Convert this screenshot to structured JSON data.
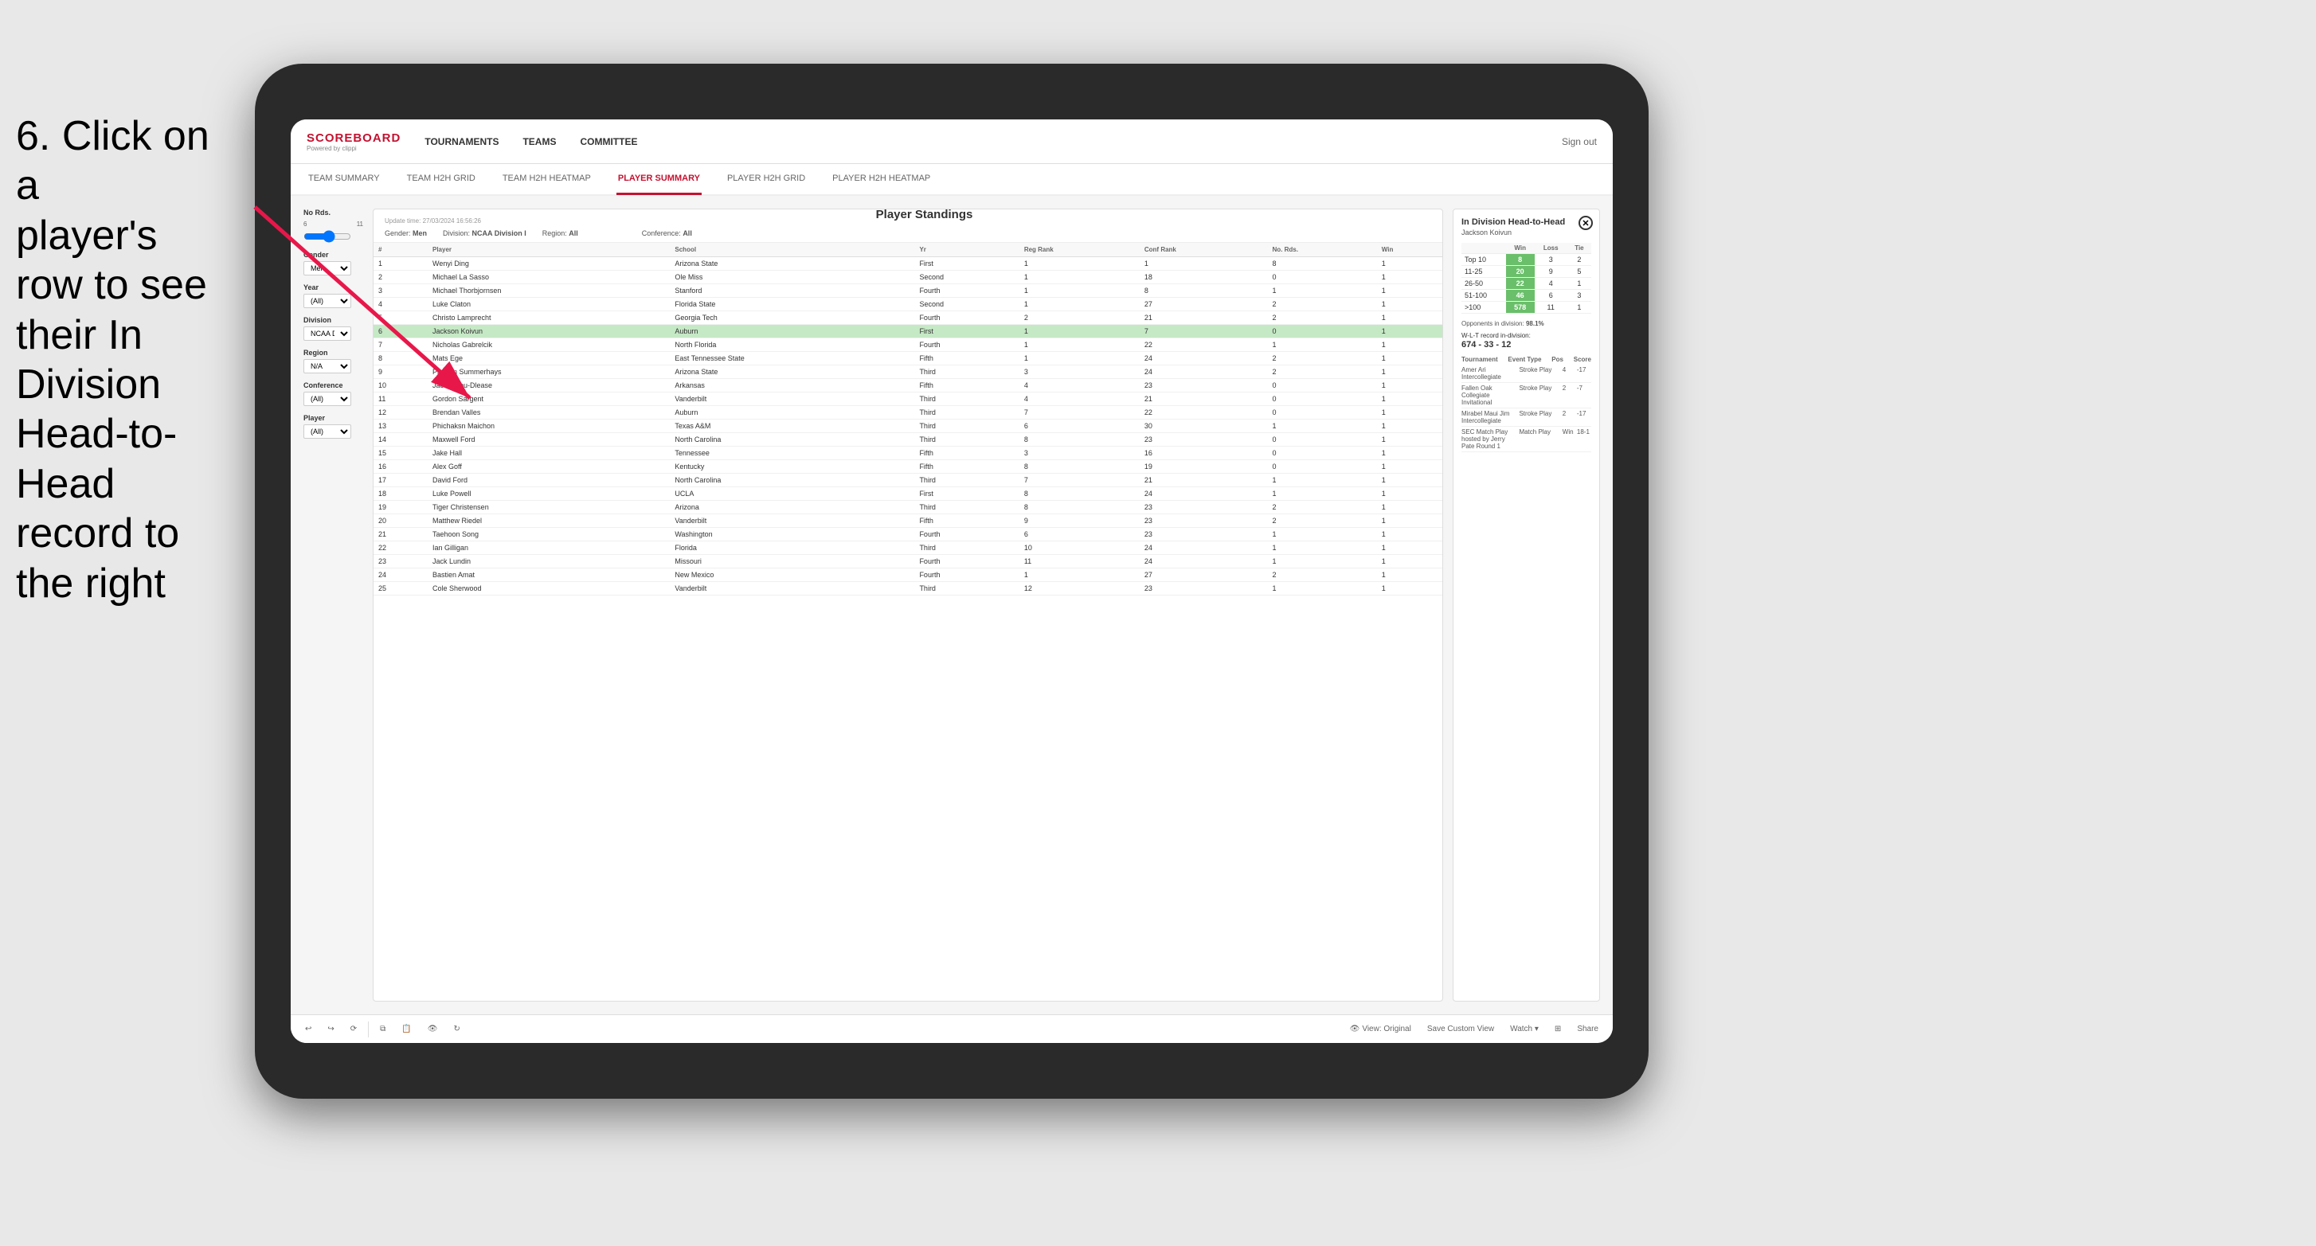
{
  "instruction": {
    "line1": "6. Click on a",
    "line2": "player's row to see",
    "line3": "their In Division",
    "line4": "Head-to-Head",
    "line5": "record to the right"
  },
  "nav": {
    "logo": "SCOREBOARD",
    "logo_sub": "Powered by clippi",
    "links": [
      "TOURNAMENTS",
      "TEAMS",
      "COMMITTEE"
    ],
    "sign_out": "Sign out"
  },
  "sub_nav": {
    "links": [
      "TEAM SUMMARY",
      "TEAM H2H GRID",
      "TEAM H2H HEATMAP",
      "PLAYER SUMMARY",
      "PLAYER H2H GRID",
      "PLAYER H2H HEATMAP"
    ],
    "active": "PLAYER SUMMARY"
  },
  "filters": {
    "no_rds_label": "No Rds.",
    "no_rds_min": "6",
    "no_rds_max": "11",
    "gender_label": "Gender",
    "gender_value": "Men",
    "year_label": "Year",
    "year_value": "(All)",
    "division_label": "Division",
    "division_value": "NCAA Division I",
    "region_label": "Region",
    "region_value": "N/A",
    "conference_label": "Conference",
    "conference_value": "(All)",
    "player_label": "Player",
    "player_value": "(All)"
  },
  "standings": {
    "update_time": "Update time:",
    "update_date": "27/03/2024 16:56:26",
    "title": "Player Standings",
    "gender": "Men",
    "division": "NCAA Division I",
    "region": "All",
    "conference": "All",
    "columns": [
      "#",
      "Player",
      "School",
      "Yr",
      "Reg Rank",
      "Conf Rank",
      "No. Rds.",
      "Win"
    ],
    "rows": [
      {
        "num": "1",
        "player": "Wenyi Ding",
        "school": "Arizona State",
        "yr": "First",
        "reg": "1",
        "conf": "1",
        "rds": "8",
        "win": "1"
      },
      {
        "num": "2",
        "player": "Michael La Sasso",
        "school": "Ole Miss",
        "yr": "Second",
        "reg": "1",
        "conf": "18",
        "rds": "0",
        "win": "1"
      },
      {
        "num": "3",
        "player": "Michael Thorbjornsen",
        "school": "Stanford",
        "yr": "Fourth",
        "reg": "1",
        "conf": "8",
        "rds": "1",
        "win": "1"
      },
      {
        "num": "4",
        "player": "Luke Claton",
        "school": "Florida State",
        "yr": "Second",
        "reg": "1",
        "conf": "27",
        "rds": "2",
        "win": "1"
      },
      {
        "num": "5",
        "player": "Christo Lamprecht",
        "school": "Georgia Tech",
        "yr": "Fourth",
        "reg": "2",
        "conf": "21",
        "rds": "2",
        "win": "1"
      },
      {
        "num": "6",
        "player": "Jackson Koivun",
        "school": "Auburn",
        "yr": "First",
        "reg": "1",
        "conf": "7",
        "rds": "0",
        "win": "1",
        "selected": true
      },
      {
        "num": "7",
        "player": "Nicholas Gabrelcik",
        "school": "North Florida",
        "yr": "Fourth",
        "reg": "1",
        "conf": "22",
        "rds": "1",
        "win": "1"
      },
      {
        "num": "8",
        "player": "Mats Ege",
        "school": "East Tennessee State",
        "yr": "Fifth",
        "reg": "1",
        "conf": "24",
        "rds": "2",
        "win": "1"
      },
      {
        "num": "9",
        "player": "Preston Summerhays",
        "school": "Arizona State",
        "yr": "Third",
        "reg": "3",
        "conf": "24",
        "rds": "2",
        "win": "1"
      },
      {
        "num": "10",
        "player": "Jacob Mou-Dlease",
        "school": "Arkansas",
        "yr": "Fifth",
        "reg": "4",
        "conf": "23",
        "rds": "0",
        "win": "1"
      },
      {
        "num": "11",
        "player": "Gordon Sargent",
        "school": "Vanderbilt",
        "yr": "Third",
        "reg": "4",
        "conf": "21",
        "rds": "0",
        "win": "1"
      },
      {
        "num": "12",
        "player": "Brendan Valles",
        "school": "Auburn",
        "yr": "Third",
        "reg": "7",
        "conf": "22",
        "rds": "0",
        "win": "1"
      },
      {
        "num": "13",
        "player": "Phichaksn Maichon",
        "school": "Texas A&M",
        "yr": "Third",
        "reg": "6",
        "conf": "30",
        "rds": "1",
        "win": "1"
      },
      {
        "num": "14",
        "player": "Maxwell Ford",
        "school": "North Carolina",
        "yr": "Third",
        "reg": "8",
        "conf": "23",
        "rds": "0",
        "win": "1"
      },
      {
        "num": "15",
        "player": "Jake Hall",
        "school": "Tennessee",
        "yr": "Fifth",
        "reg": "3",
        "conf": "16",
        "rds": "0",
        "win": "1"
      },
      {
        "num": "16",
        "player": "Alex Goff",
        "school": "Kentucky",
        "yr": "Fifth",
        "reg": "8",
        "conf": "19",
        "rds": "0",
        "win": "1"
      },
      {
        "num": "17",
        "player": "David Ford",
        "school": "North Carolina",
        "yr": "Third",
        "reg": "7",
        "conf": "21",
        "rds": "1",
        "win": "1"
      },
      {
        "num": "18",
        "player": "Luke Powell",
        "school": "UCLA",
        "yr": "First",
        "reg": "8",
        "conf": "24",
        "rds": "1",
        "win": "1"
      },
      {
        "num": "19",
        "player": "Tiger Christensen",
        "school": "Arizona",
        "yr": "Third",
        "reg": "8",
        "conf": "23",
        "rds": "2",
        "win": "1"
      },
      {
        "num": "20",
        "player": "Matthew Riedel",
        "school": "Vanderbilt",
        "yr": "Fifth",
        "reg": "9",
        "conf": "23",
        "rds": "2",
        "win": "1"
      },
      {
        "num": "21",
        "player": "Taehoon Song",
        "school": "Washington",
        "yr": "Fourth",
        "reg": "6",
        "conf": "23",
        "rds": "1",
        "win": "1"
      },
      {
        "num": "22",
        "player": "Ian Gilligan",
        "school": "Florida",
        "yr": "Third",
        "reg": "10",
        "conf": "24",
        "rds": "1",
        "win": "1"
      },
      {
        "num": "23",
        "player": "Jack Lundin",
        "school": "Missouri",
        "yr": "Fourth",
        "reg": "11",
        "conf": "24",
        "rds": "1",
        "win": "1"
      },
      {
        "num": "24",
        "player": "Bastien Amat",
        "school": "New Mexico",
        "yr": "Fourth",
        "reg": "1",
        "conf": "27",
        "rds": "2",
        "win": "1"
      },
      {
        "num": "25",
        "player": "Cole Sherwood",
        "school": "Vanderbilt",
        "yr": "Third",
        "reg": "12",
        "conf": "23",
        "rds": "1",
        "win": "1"
      }
    ]
  },
  "h2h": {
    "title": "In Division Head-to-Head",
    "player": "Jackson Koivun",
    "table_headers": [
      "",
      "Win",
      "Loss",
      "Tie"
    ],
    "rows": [
      {
        "label": "Top 10",
        "win": "8",
        "loss": "3",
        "tie": "2"
      },
      {
        "label": "11-25",
        "win": "20",
        "loss": "9",
        "tie": "5"
      },
      {
        "label": "26-50",
        "win": "22",
        "loss": "4",
        "tie": "1"
      },
      {
        "label": "51-100",
        "win": "46",
        "loss": "6",
        "tie": "3"
      },
      {
        "label": ">100",
        "win": "578",
        "loss": "11",
        "tie": "1"
      }
    ],
    "opponents_label": "Opponents in division:",
    "opponents_pct": "98.1%",
    "wl_label": "W-L-T record in-division:",
    "wl_record": "674 - 33 - 12",
    "tournament_headers": [
      "Tournament",
      "Event Type",
      "Pos",
      "Score"
    ],
    "tournaments": [
      {
        "name": "Amer Ari Intercollegiate",
        "type": "Stroke Play",
        "pos": "4",
        "score": "-17"
      },
      {
        "name": "Fallen Oak Collegiate Invitational",
        "type": "Stroke Play",
        "pos": "2",
        "score": "-7"
      },
      {
        "name": "Mirabel Maui Jim Intercollegiate",
        "type": "Stroke Play",
        "pos": "2",
        "score": "-17"
      },
      {
        "name": "SEC Match Play hosted by Jerry Pate Round 1",
        "type": "Match Play",
        "pos": "Win",
        "score": "18-1"
      }
    ]
  },
  "toolbar": {
    "undo": "↩",
    "redo": "↪",
    "forward": "⟳",
    "view_original": "View: Original",
    "save_custom": "Save Custom View",
    "watch": "Watch ▾",
    "share": "Share"
  }
}
